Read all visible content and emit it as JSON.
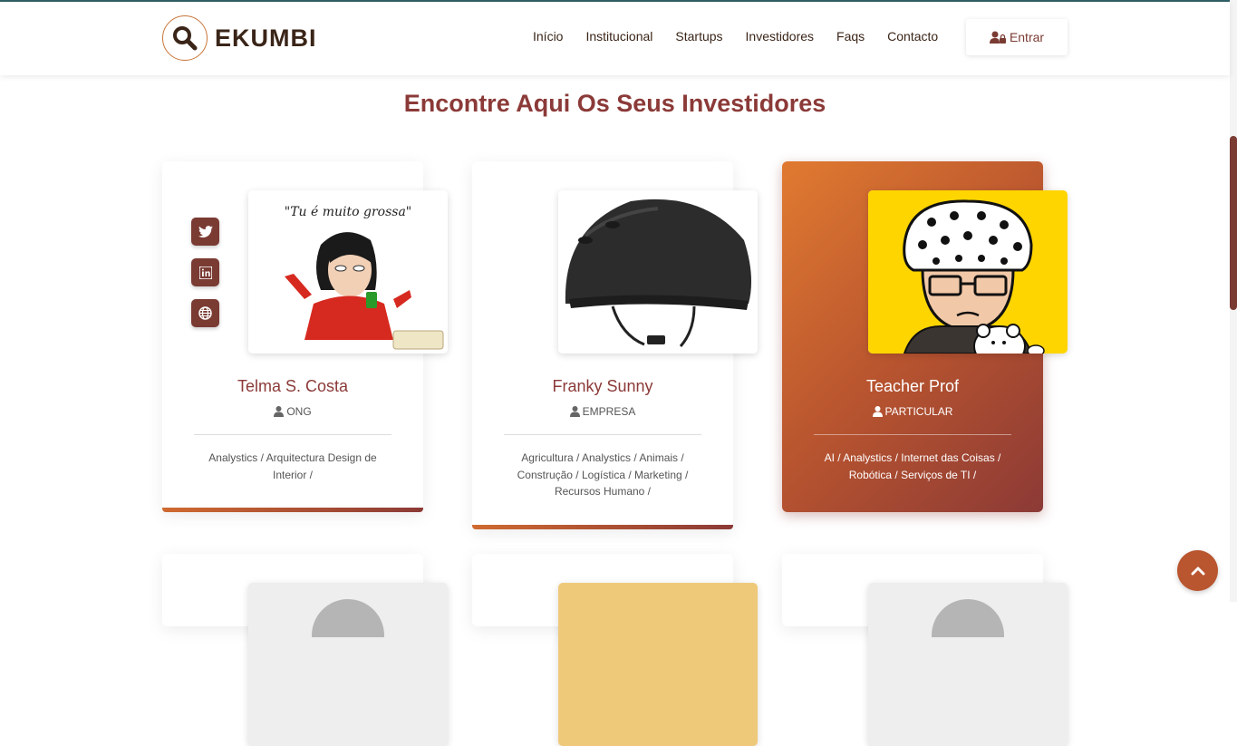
{
  "brand": {
    "name": "EKUMBI"
  },
  "nav": {
    "items": [
      "Início",
      "Institucional",
      "Startups",
      "Investidores",
      "Faqs",
      "Contacto"
    ],
    "login_label": "Entrar"
  },
  "page": {
    "title": "Encontre Aqui Os Seus Investidores"
  },
  "investors": [
    {
      "name": "Telma S. Costa",
      "type": "ONG",
      "sectors": "Analystics / Arquitectura Design de Interior /",
      "photo_caption": "\"Tu é muito grossa\""
    },
    {
      "name": "Franky Sunny",
      "type": "EMPRESA",
      "sectors": "Agricultura / Analystics / Animais / Construção / Logística / Marketing / Recursos Humano /"
    },
    {
      "name": "Teacher Prof",
      "type": "PARTICULAR",
      "sectors": "AI / Analystics / Internet das Coisas / Robótica / Serviços de TI /"
    }
  ],
  "colors": {
    "accent": "#8b3a38",
    "accent_orange": "#e07a30",
    "brand_dark": "#3a2518"
  }
}
